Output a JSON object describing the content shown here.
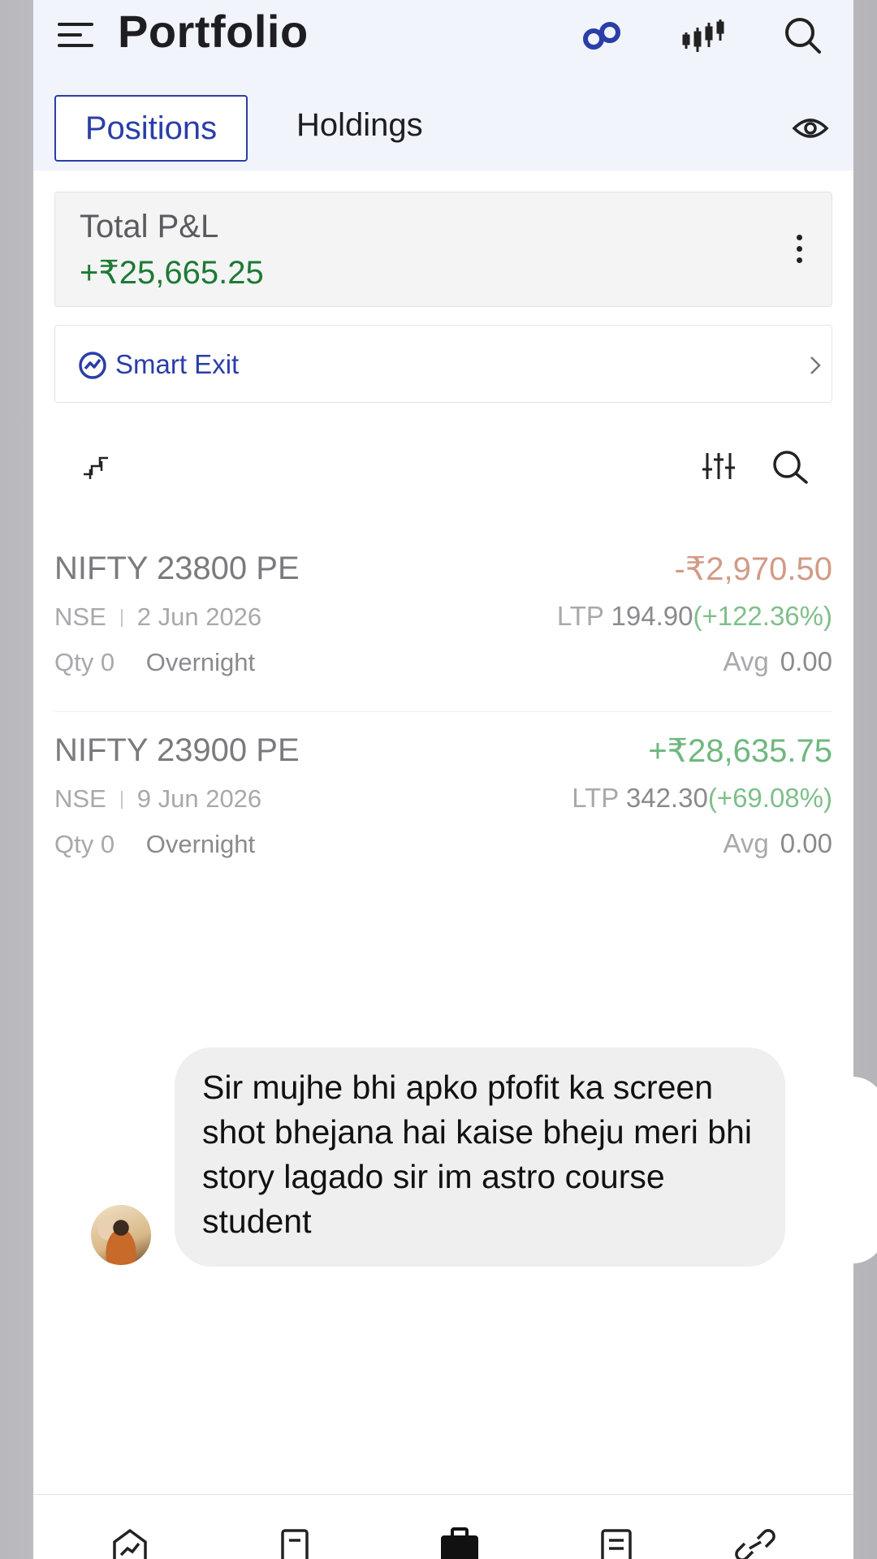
{
  "header": {
    "title": "Portfolio",
    "icons": [
      "menu-icon",
      "infinity-icon",
      "candlestick-icon",
      "search-icon"
    ]
  },
  "tabs": {
    "positions": "Positions",
    "holdings": "Holdings"
  },
  "pnl": {
    "label": "Total P&L",
    "value": "+₹25,665.25"
  },
  "smart_exit": {
    "label": "Smart Exit"
  },
  "positions": [
    {
      "name": "NIFTY 23800 PE",
      "pnl": "-₹2,970.50",
      "exchange": "NSE",
      "expiry": "2 Jun 2026",
      "ltp_label": "LTP",
      "ltp": "194.90",
      "change": "(+122.36%)",
      "qty_label": "Qty",
      "qty": "0",
      "product": "Overnight",
      "avg_label": "Avg",
      "avg": "0.00"
    },
    {
      "name": "NIFTY 23900 PE",
      "pnl": "+₹28,635.75",
      "exchange": "NSE",
      "expiry": "9 Jun 2026",
      "ltp_label": "LTP",
      "ltp": "342.30",
      "change": "(+69.08%)",
      "qty_label": "Qty",
      "qty": "0",
      "product": "Overnight",
      "avg_label": "Avg",
      "avg": "0.00"
    }
  ],
  "chat": {
    "message": "Sir mujhe bhi apko pfofit ka screen shot bhejana hai kaise bheju meri bhi story lagado sir im astro course student"
  },
  "colors": {
    "accent": "#2a3ea8",
    "profit": "#1d7a34",
    "loss_faded": "#d39a86",
    "profit_faded": "#6fb77f"
  }
}
